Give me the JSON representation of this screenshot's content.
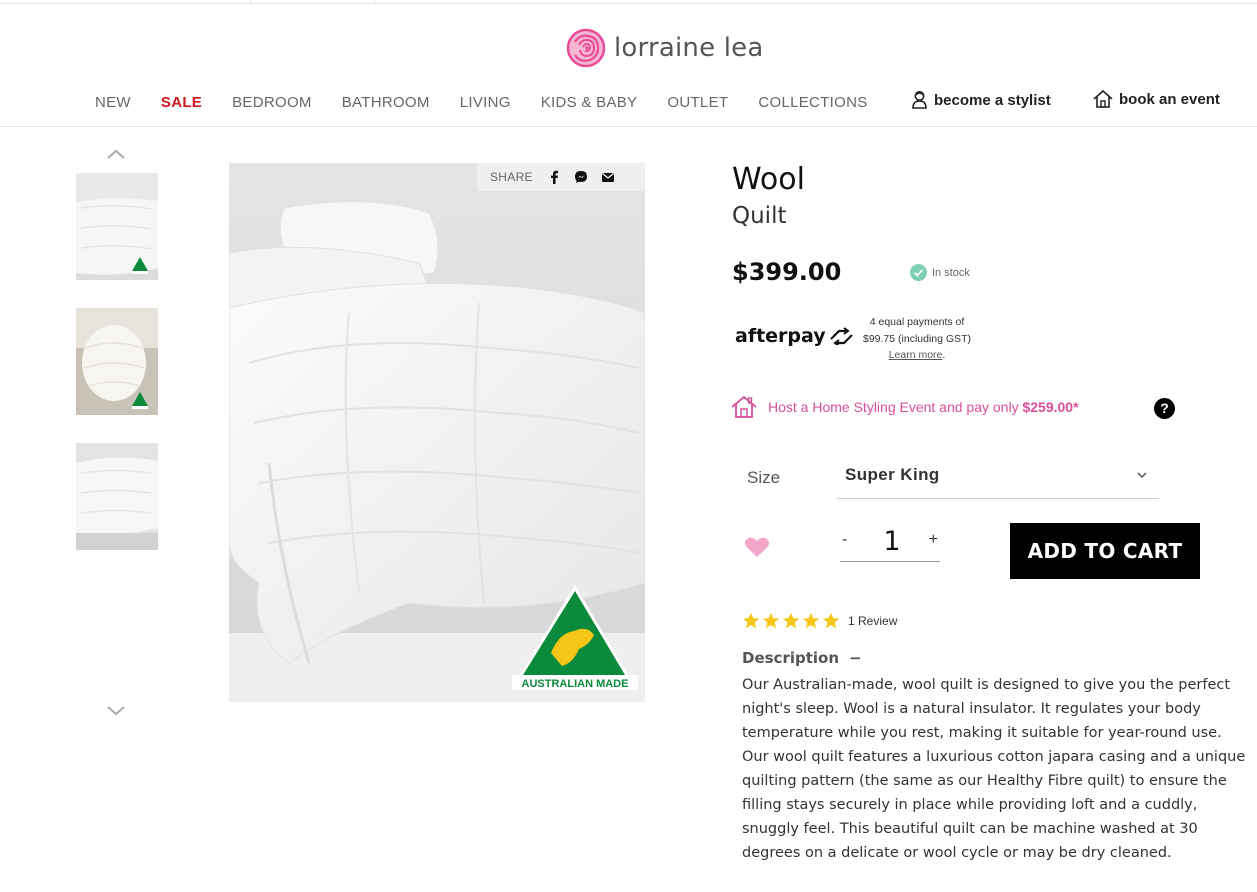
{
  "colors": {
    "brand_pink": "#e94b97",
    "sale_red": "#d0141e",
    "host_pink": "#d94f9a",
    "cart_bg": "#000000",
    "star_yellow": "#f5c518",
    "heart_pink": "#f2a6c8",
    "stock_check": "#7dcfb6"
  },
  "header": {
    "logo_text": "lorraine lea",
    "logo_icon": "rose-icon"
  },
  "nav": {
    "items": [
      "NEW",
      "SALE",
      "BEDROOM",
      "BATHROOM",
      "LIVING",
      "KIDS & BABY",
      "OUTLET",
      "COLLECTIONS"
    ],
    "become_stylist": "become a stylist",
    "book_event": "book an event"
  },
  "gallery": {
    "thumbnails": [
      "wool-quilt-bed",
      "wool-quilt-rolled",
      "wool-quilt-side"
    ],
    "badge_text": "AUSTRALIAN MADE",
    "share_label": "SHARE"
  },
  "product": {
    "title": "Wool",
    "subtitle": "Quilt",
    "price": "$399.00",
    "stock_status": "In stock",
    "afterpay": {
      "logo": "afterpay",
      "line1": "4 equal payments of",
      "line2": "$99.75 (including GST)",
      "learn_more": "Learn more",
      "period": "."
    },
    "host_offer": {
      "text": "Host a Home Styling Event and pay only",
      "price": "$259.00*"
    },
    "help": "?",
    "size": {
      "label": "Size",
      "selected": "Super King"
    },
    "quantity": {
      "minus": "-",
      "value": "1",
      "plus": "+"
    },
    "add_to_cart": "ADD TO CART",
    "rating": {
      "stars": 5,
      "review_count": "1 Review"
    },
    "description": {
      "heading": "Description",
      "toggle": "−",
      "text": "Our Australian-made, wool quilt is designed to give you the perfect night's sleep. Wool is a natural insulator. It regulates your body temperature while you rest, making it suitable for year-round use. Our wool quilt features a luxurious cotton japara casing and a unique quilting pattern (the same as our Healthy Fibre quilt) to ensure the filling stays securely in place while providing loft and a cuddly, snuggly feel. This beautiful quilt can be machine washed at 30 degrees on a delicate or wool cycle or may be dry cleaned."
    }
  }
}
